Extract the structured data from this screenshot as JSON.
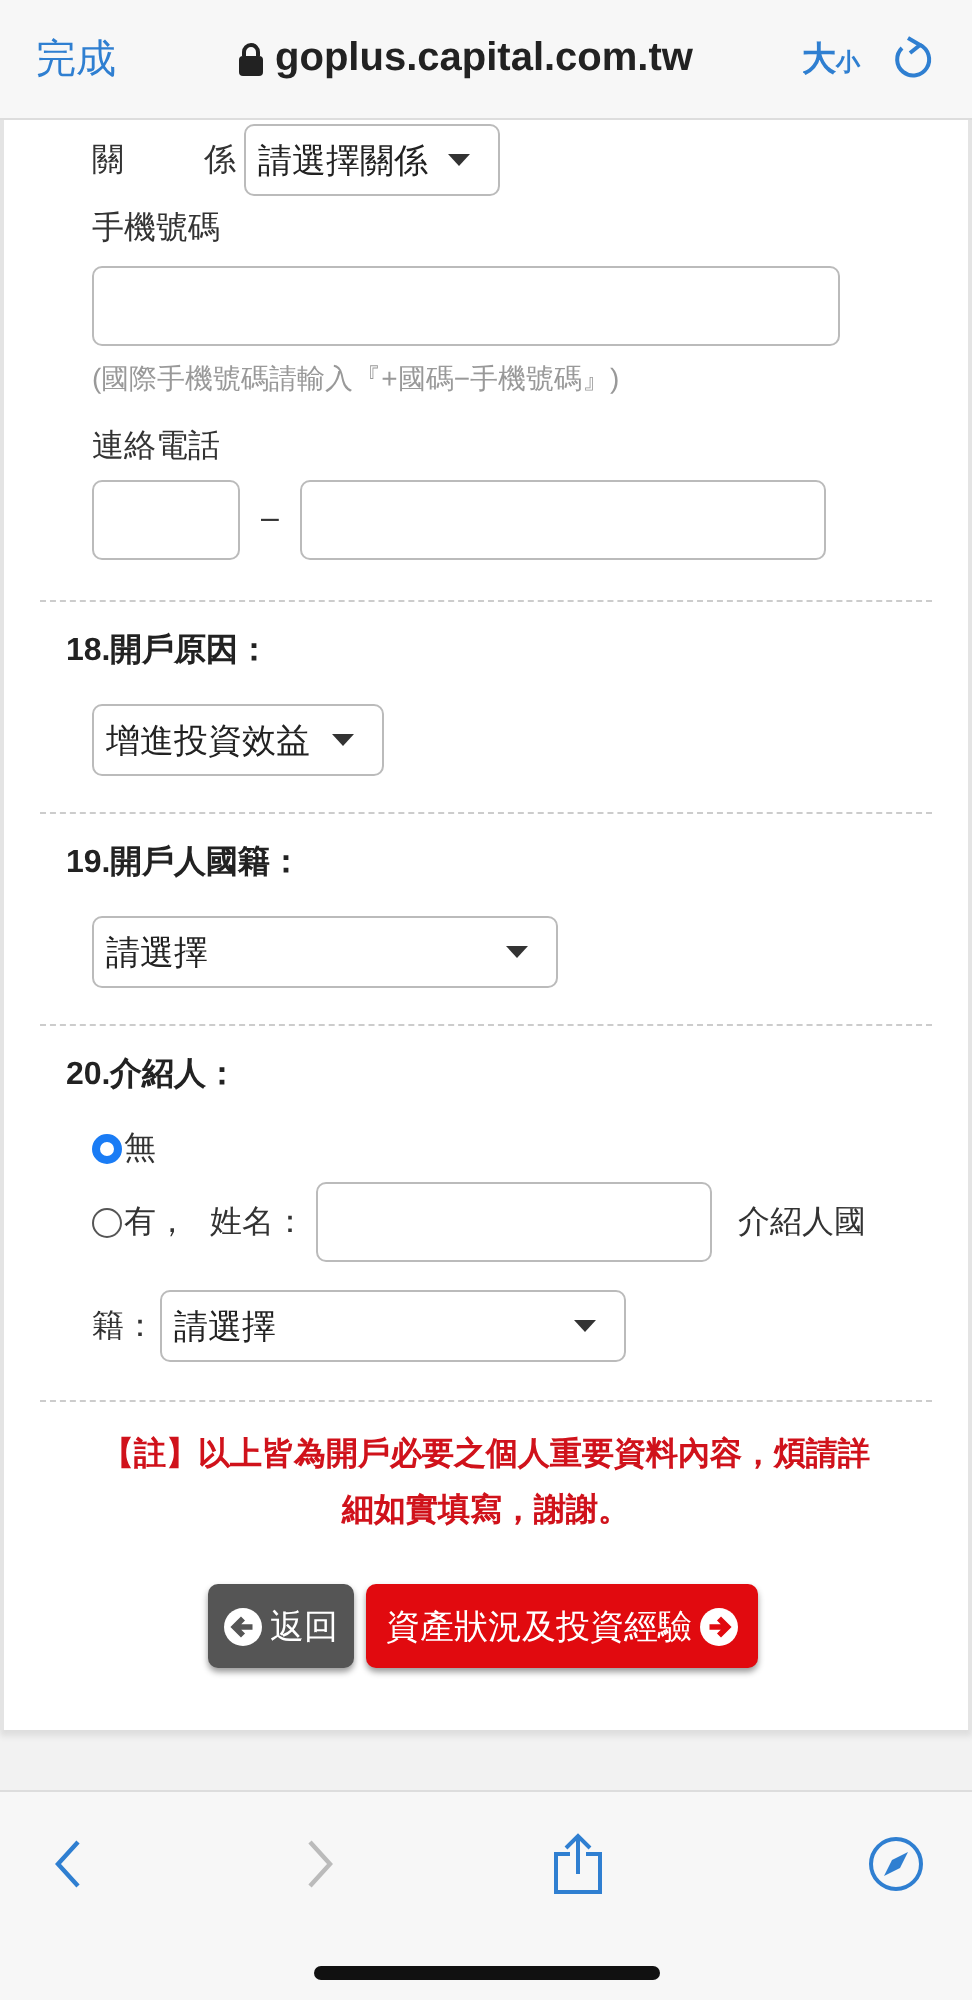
{
  "browser": {
    "done": "完成",
    "url": "goplus.capital.com.tw",
    "text_size_main": "大",
    "text_size_small": "小"
  },
  "contact": {
    "relation_label": "關　係",
    "relation_select": "請選擇關係",
    "mobile_label": "手機號碼",
    "mobile_hint": "(國際手機號碼請輸入『+國碼−手機號碼』)",
    "phone_label": "連絡電話",
    "phone_dash": "–"
  },
  "reason": {
    "title": "18.開戶原因：",
    "select": "增進投資效益"
  },
  "nationality": {
    "title": "19.開戶人國籍：",
    "select": "請選擇"
  },
  "referrer": {
    "title": "20.介紹人：",
    "options": [
      {
        "label": "無",
        "selected": true
      },
      {
        "label": "有，",
        "selected": false
      }
    ],
    "name_label": "姓名：",
    "nationality_label_start": "介紹人國",
    "nationality_label_end": "籍：",
    "nationality_select": "請選擇"
  },
  "note": "【註】以上皆為開戶必要之個人重要資料內容，煩請詳細如實填寫，謝謝。",
  "buttons": {
    "back": "返回",
    "next": "資產狀況及投資經驗"
  }
}
